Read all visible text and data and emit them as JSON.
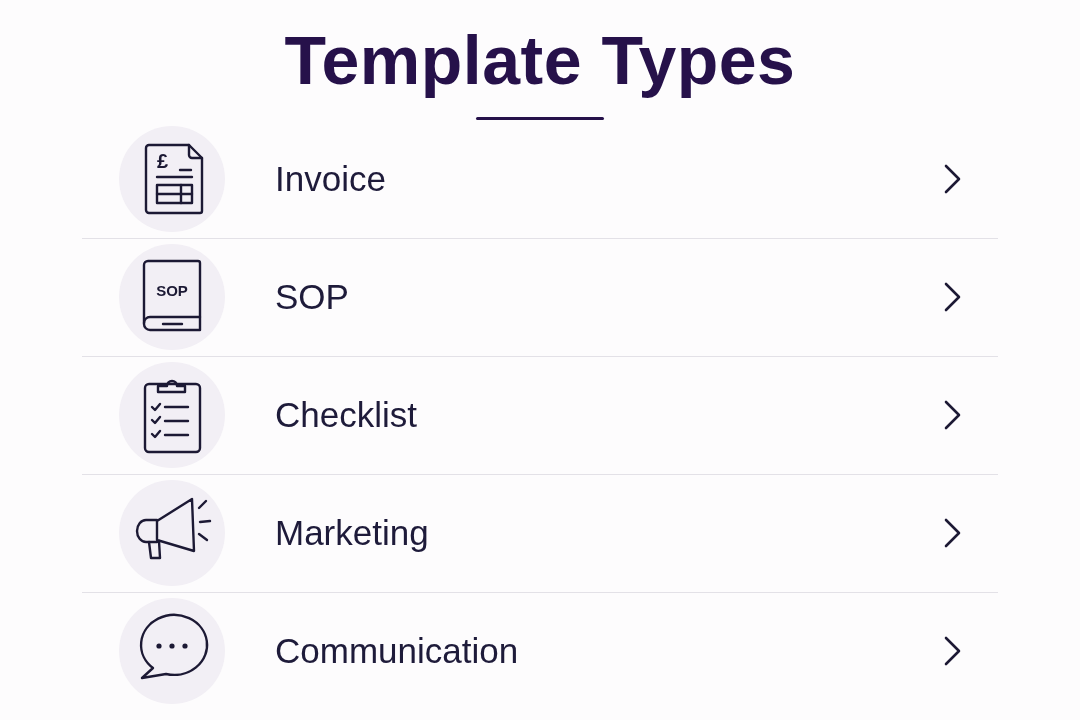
{
  "title": "Template Types",
  "items": [
    {
      "kind": "invoice",
      "label": "Invoice",
      "icon_text": "£"
    },
    {
      "kind": "book",
      "label": "SOP",
      "icon_text": "SOP"
    },
    {
      "kind": "checklist",
      "label": "Checklist"
    },
    {
      "kind": "megaphone",
      "label": "Marketing"
    },
    {
      "kind": "chat",
      "label": "Communication"
    }
  ]
}
